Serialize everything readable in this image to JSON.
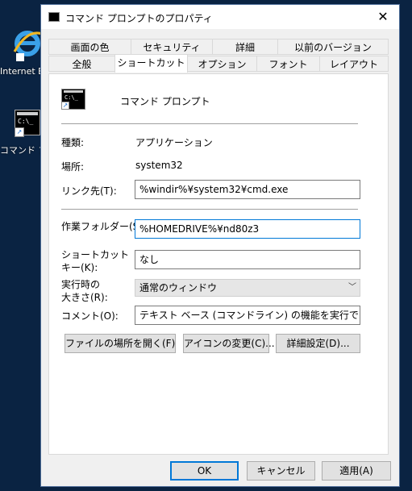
{
  "desktop": {
    "icons": [
      {
        "label": "Internet E",
        "icon": "internet-explorer-icon"
      },
      {
        "label": "コマンド プ",
        "icon": "command-prompt-shortcut-icon"
      }
    ]
  },
  "window": {
    "title": "コマンド プロンプトのプロパティ",
    "close_glyph": "✕"
  },
  "tabs": {
    "row1": [
      "画面の色",
      "セキュリティ",
      "詳細",
      "以前のバージョン"
    ],
    "row2": [
      "全般",
      "ショートカット",
      "オプション",
      "フォント",
      "レイアウト"
    ],
    "active": "ショートカット"
  },
  "shortcut": {
    "name": "コマンド プロンプト",
    "type_label": "種類:",
    "type_value": "アプリケーション",
    "location_label": "場所:",
    "location_value": "system32",
    "target_label": "リンク先(T):",
    "target_value": "%windir%¥system32¥cmd.exe",
    "startin_label": "作業フォルダー(S):",
    "startin_value": "%HOMEDRIVE%¥nd80z3",
    "hotkey_label_1": "ショートカット",
    "hotkey_label_2": "キー(K):",
    "hotkey_value": "なし",
    "run_label_1": "実行時の",
    "run_label_2": "大きさ(R):",
    "run_value": "通常のウィンドウ",
    "comment_label": "コメント(O):",
    "comment_value": "テキスト ベース (コマンドライン) の機能を実行できます。",
    "open_location_button": "ファイルの場所を開く(F)",
    "change_icon_button": "アイコンの変更(C)...",
    "advanced_button": "詳細設定(D)..."
  },
  "footer": {
    "ok": "OK",
    "cancel": "キャンセル",
    "apply": "適用(A)"
  }
}
